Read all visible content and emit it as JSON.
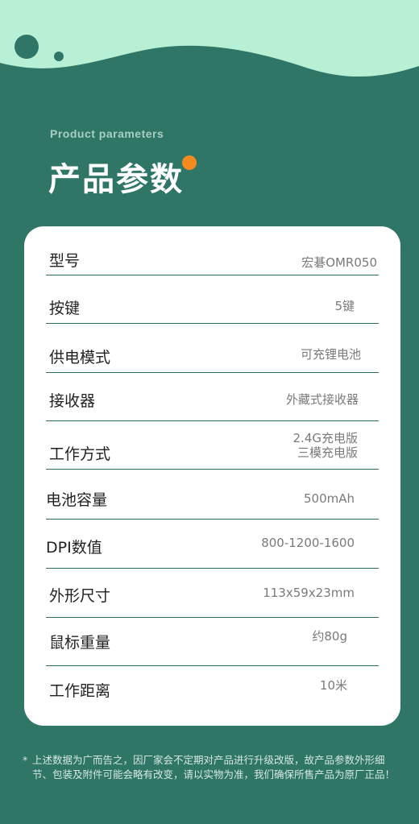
{
  "header": {
    "subtitle": "Product parameters",
    "title": "产品参数"
  },
  "colors": {
    "background": "#2f7667",
    "wave": "#b8f0d6",
    "accent_orange": "#f58a1f",
    "accent_green": "#2f7667",
    "card": "#ffffff"
  },
  "params": [
    {
      "label": "型号",
      "value": "宏碁OMR050"
    },
    {
      "label": "按键",
      "value": "5键"
    },
    {
      "label": "供电模式",
      "value": "可充锂电池"
    },
    {
      "label": "接收器",
      "value": "外藏式接收器"
    },
    {
      "label": "工作方式",
      "value": "2.4G充电版",
      "value2": "三模充电版"
    },
    {
      "label": "电池容量",
      "value": "500mAh"
    },
    {
      "label": "DPI数值",
      "value": "800-1200-1600"
    },
    {
      "label": "外形尺寸",
      "value": "113x59x23mm"
    },
    {
      "label": "鼠标重量",
      "value": "约80g"
    },
    {
      "label": "工作距离",
      "value": "10米"
    }
  ],
  "footnote": {
    "asterisk": "*",
    "text": "上述数据为广而告之，因厂家会不定期对产品进行升级改版，故产品参数外形细节、包装及附件可能会略有改变，请以实物为准，我们确保所售产品为原厂正品！"
  }
}
